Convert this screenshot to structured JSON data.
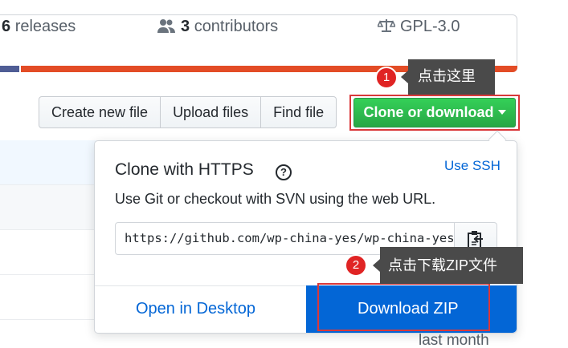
{
  "summary": {
    "releases_count": "6",
    "releases_label": "releases",
    "contributors_count": "3",
    "contributors_label": "contributors",
    "license": "GPL-3.0"
  },
  "toolbar": {
    "create_new_file": "Create new file",
    "upload_files": "Upload files",
    "find_file": "Find file",
    "clone_download": "Clone or download"
  },
  "clone_panel": {
    "title": "Clone with HTTPS",
    "help_glyph": "?",
    "use_ssh": "Use SSH",
    "description": "Use Git or checkout with SVN using the web URL.",
    "url": "https://github.com/wp-china-yes/wp-china-yes.git",
    "open_desktop": "Open in Desktop",
    "download_zip": "Download ZIP"
  },
  "file_list": {
    "last_timestamp": "last month"
  },
  "annotations": {
    "step1_number": "1",
    "step1_text": "点击这里",
    "step2_number": "2",
    "step2_text": "点击下载ZIP文件"
  },
  "colors": {
    "primary_green": "#28a745",
    "link_blue": "#0366d6",
    "highlight_red": "#d9383a",
    "language_main": "#e34c26",
    "language_secondary": "#4F5D95"
  },
  "icons": [
    "people-icon",
    "law-icon",
    "question-icon",
    "clipboard-icon",
    "caret-down-icon"
  ]
}
